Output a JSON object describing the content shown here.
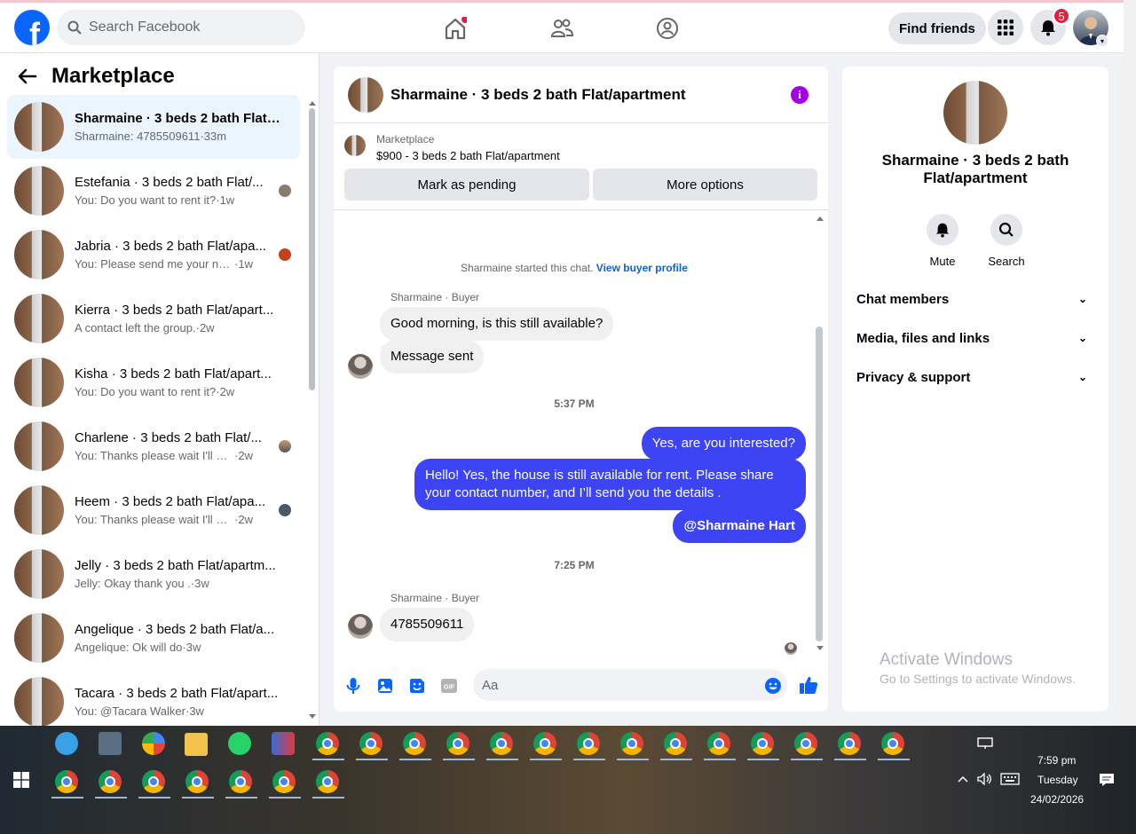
{
  "header": {
    "search_placeholder": "Search Facebook",
    "find_friends": "Find friends",
    "notification_count": "5",
    "brand_color": "#0866ff"
  },
  "sidebar": {
    "title": "Marketplace",
    "conversations": [
      {
        "name": "Sharmaine · 3 beds 2 bath Flat/a...",
        "preview": "Sharmaine: 4785509611",
        "time": "33m",
        "active": true
      },
      {
        "name": "Estefania · 3 beds 2 bath Flat/...",
        "preview": "You: Do you want to rent it?",
        "time": "1w"
      },
      {
        "name": "Jabria · 3 beds 2 bath Flat/apa...",
        "preview": "You: Please send me your numb...",
        "time": "1w"
      },
      {
        "name": "Kierra · 3 beds 2 bath Flat/apart...",
        "preview": "A contact left the group.",
        "time": "2w"
      },
      {
        "name": "Kisha · 3 beds 2 bath Flat/apart...",
        "preview": "You: Do you want to rent it?",
        "time": "2w"
      },
      {
        "name": "Charlene · 3 beds 2 bath Flat/...",
        "preview": "You: Thanks please wait I'll mess...",
        "time": "2w"
      },
      {
        "name": "Heem · 3 beds 2 bath Flat/apa...",
        "preview": "You: Thanks please wait I'll mess...",
        "time": "2w"
      },
      {
        "name": "Jelly · 3 beds 2 bath Flat/apartm...",
        "preview": "Jelly: Okay thank you .",
        "time": "3w"
      },
      {
        "name": "Angelique · 3 beds 2 bath Flat/a...",
        "preview": "Angelique: Ok will do",
        "time": "3w"
      },
      {
        "name": "Tacara · 3 beds 2 bath Flat/apart...",
        "preview": "You: @Tacara Walker",
        "time": "3w"
      }
    ]
  },
  "chat": {
    "title": "Sharmaine · 3 beds 2 bath Flat/apartment",
    "marketplace_label": "Marketplace",
    "listing": "$900 - 3 beds 2 bath Flat/apartment",
    "mark_pending": "Mark as pending",
    "more_options": "More options",
    "started_text": "Sharmaine started this chat.",
    "view_profile": "View buyer profile",
    "sender_label": "Sharmaine · Buyer",
    "msg1": "Good morning, is this still available?",
    "msg2": "Message sent",
    "time1": "5:37 PM",
    "out1": "Yes, are you interested?",
    "out2": "Hello! Yes, the house is still available for rent. Please share your contact number, and I’ll send you the details .",
    "out3": "@Sharmaine Hart",
    "time2": "7:25 PM",
    "msg3": "4785509611",
    "input_placeholder": "Aa"
  },
  "details": {
    "name": "Sharmaine · 3 beds 2 bath Flat/apartment",
    "mute": "Mute",
    "search": "Search",
    "sections": [
      "Chat members",
      "Media, files and links",
      "Privacy & support"
    ]
  },
  "watermark": {
    "line1": "Activate Windows",
    "line2": "Go to Settings to activate Windows."
  },
  "taskbar": {
    "time": "7:59 pm",
    "day": "Tuesday",
    "date": "24/02/2026"
  }
}
